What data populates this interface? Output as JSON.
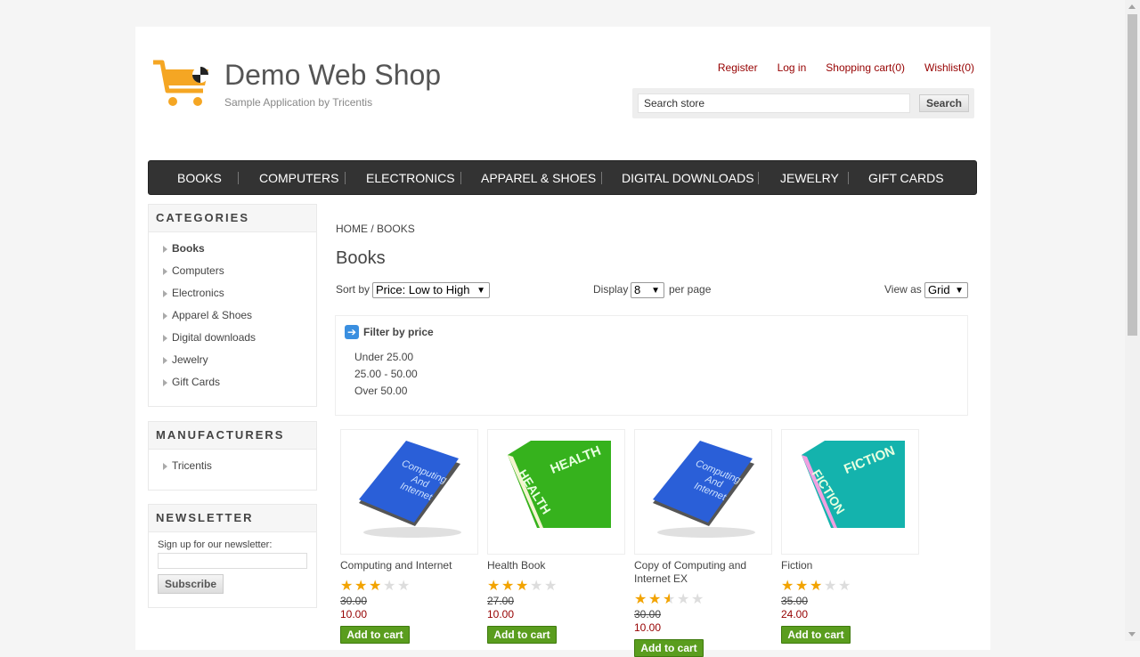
{
  "header": {
    "logo_title": "Demo Web Shop",
    "logo_subtitle": "Sample Application by Tricentis",
    "links": [
      "Register",
      "Log in",
      "Shopping cart(0)",
      "Wishlist(0)"
    ],
    "search_value": "Search store",
    "search_button": "Search"
  },
  "nav": [
    "BOOKS",
    "COMPUTERS",
    "ELECTRONICS",
    "APPAREL & SHOES",
    "DIGITAL DOWNLOADS",
    "JEWELRY",
    "GIFT CARDS"
  ],
  "sidebar": {
    "categories_title": "CATEGORIES",
    "categories": [
      "Books",
      "Computers",
      "Electronics",
      "Apparel & Shoes",
      "Digital downloads",
      "Jewelry",
      "Gift Cards"
    ],
    "manufacturers_title": "MANUFACTURERS",
    "manufacturers": [
      "Tricentis"
    ],
    "newsletter_title": "NEWSLETTER",
    "newsletter_label": "Sign up for our newsletter:",
    "subscribe_button": "Subscribe"
  },
  "main": {
    "breadcrumb_home": "HOME",
    "breadcrumb_sep": "/",
    "breadcrumb_current": "BOOKS",
    "title": "Books",
    "sort_label": "Sort by",
    "sort_value": "Price: Low to High",
    "display_label": "Display",
    "display_value": "8",
    "per_page_label": "per page",
    "view_label": "View as",
    "view_value": "Grid",
    "filter_title": "Filter by price",
    "filter_options": [
      "Under 25.00",
      "25.00 - 50.00",
      "Over 50.00"
    ]
  },
  "products": [
    {
      "name": "Computing and Internet",
      "rating": 3,
      "old_price": "30.00",
      "price": "10.00",
      "button": "Add to cart",
      "cover_text": "Computing And Internet",
      "cover_color": "#2a5fd8"
    },
    {
      "name": "Health Book",
      "rating": 3,
      "old_price": "27.00",
      "price": "10.00",
      "button": "Add to cart",
      "cover_text": "HEALTH",
      "cover_color": "#36b21d"
    },
    {
      "name": "Copy of Computing and Internet EX",
      "rating": 2.5,
      "old_price": "30.00",
      "price": "10.00",
      "button": "Add to cart",
      "cover_text": "Computing And Internet",
      "cover_color": "#2a5fd8"
    },
    {
      "name": "Fiction",
      "rating": 3,
      "old_price": "35.00",
      "price": "24.00",
      "button": "Add to cart",
      "cover_text": "FICTION",
      "cover_color": "#14b3ad"
    }
  ],
  "colors": {
    "link": "#960000",
    "nav_bg": "#333333",
    "cart_button": "#5a9d1e",
    "accent": "#f2a300"
  }
}
